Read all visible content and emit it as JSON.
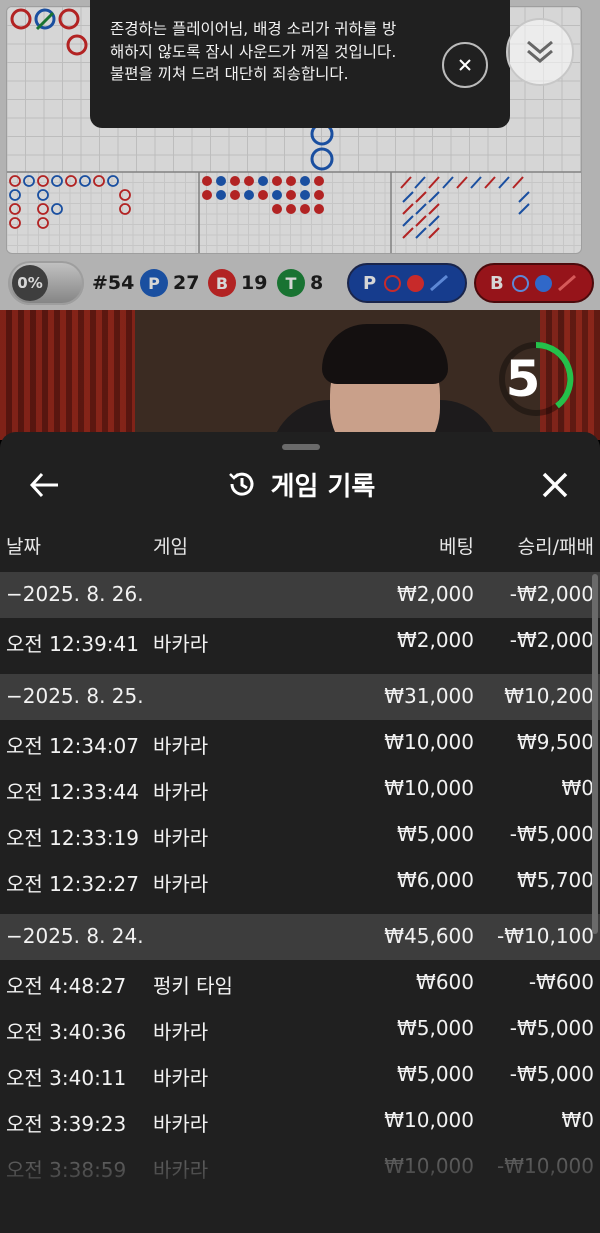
{
  "toast": {
    "message": "존경하는 플레이어님, 배경 소리가 귀하를 방해하지 않도록 잠시 사운드가 꺼질 것입니다. 불편을 끼쳐 드려 대단히 죄송합니다."
  },
  "stats": {
    "percent": "0%",
    "round": "#54",
    "player_letter": "P",
    "player_count": "27",
    "banker_letter": "B",
    "banker_count": "19",
    "tie_letter": "T",
    "tie_count": "8",
    "player_predict_letter": "P",
    "banker_predict_letter": "B"
  },
  "video": {
    "timer": "5"
  },
  "history": {
    "title": "게임 기록",
    "columns": {
      "date": "날짜",
      "game": "게임",
      "bet": "베팅",
      "result": "승리/패배"
    },
    "rows": [
      {
        "kind": "group",
        "date": "−2025. 8. 26.",
        "game": "",
        "bet": "₩2,000",
        "result": "-₩2,000"
      },
      {
        "kind": "item",
        "date": "오전 12:39:41",
        "game": "바카라",
        "bet": "₩2,000",
        "result": "-₩2,000"
      },
      {
        "kind": "group",
        "date": "−2025. 8. 25.",
        "game": "",
        "bet": "₩31,000",
        "result": "₩10,200"
      },
      {
        "kind": "item",
        "date": "오전 12:34:07",
        "game": "바카라",
        "bet": "₩10,000",
        "result": "₩9,500"
      },
      {
        "kind": "item",
        "date": "오전 12:33:44",
        "game": "바카라",
        "bet": "₩10,000",
        "result": "₩0"
      },
      {
        "kind": "item",
        "date": "오전 12:33:19",
        "game": "바카라",
        "bet": "₩5,000",
        "result": "-₩5,000"
      },
      {
        "kind": "item",
        "date": "오전 12:32:27",
        "game": "바카라",
        "bet": "₩6,000",
        "result": "₩5,700"
      },
      {
        "kind": "group",
        "date": "−2025. 8. 24.",
        "game": "",
        "bet": "₩45,600",
        "result": "-₩10,100"
      },
      {
        "kind": "item",
        "date": "오전 4:48:27",
        "game": "펑키 타임",
        "bet": "₩600",
        "result": "-₩600"
      },
      {
        "kind": "item",
        "date": "오전 3:40:36",
        "game": "바카라",
        "bet": "₩5,000",
        "result": "-₩5,000"
      },
      {
        "kind": "item",
        "date": "오전 3:40:11",
        "game": "바카라",
        "bet": "₩5,000",
        "result": "-₩5,000"
      },
      {
        "kind": "item",
        "date": "오전 3:39:23",
        "game": "바카라",
        "bet": "₩10,000",
        "result": "₩0"
      },
      {
        "kind": "item",
        "date": "오전 3:38:59",
        "game": "바카라",
        "bet": "₩10,000",
        "result": "-₩10,000"
      }
    ]
  },
  "colors": {
    "player": "#1f5fbf",
    "banker": "#d52a2a",
    "tie": "#1e8a3c",
    "panel": "#202020",
    "group_row": "#3d3d3d"
  }
}
